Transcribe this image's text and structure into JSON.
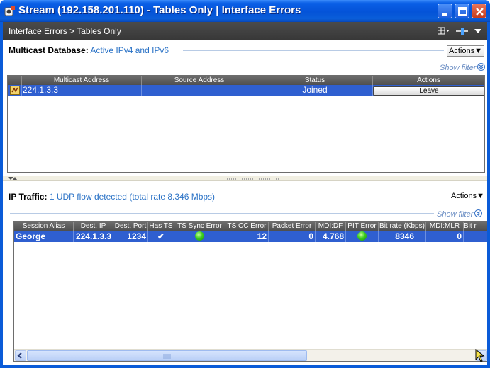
{
  "window": {
    "title": "Stream (192.158.201.110) - Tables Only | Interface Errors",
    "brand_color": "#0453d8"
  },
  "breadcrumb": {
    "text": "Interface Errors > Tables Only"
  },
  "multicast": {
    "label": "Multicast Database:",
    "status": "Active IPv4 and IPv6",
    "actions_label": "Actions",
    "show_filter": "Show filter",
    "columns": [
      "Multicast Address",
      "Source Address",
      "Status",
      "Actions"
    ],
    "rows": [
      {
        "multicast_address": "224.1.3.3",
        "source_address": "",
        "status": "Joined",
        "action": "Leave"
      }
    ]
  },
  "ip_traffic": {
    "label": "IP Traffic:",
    "status": "1 UDP flow detected (total rate 8.346 Mbps)",
    "actions_label": "Actions",
    "show_filter": "Show filter",
    "columns": [
      "Session Alias",
      "Dest. IP",
      "Dest. Port",
      "Has TS",
      "TS Sync Error",
      "TS CC Error",
      "Packet Error",
      "MDI:DF",
      "PIT Error",
      "Bit rate (Kbps)",
      "MDI:MLR",
      "Bit r"
    ],
    "rows": [
      {
        "session_alias": "George",
        "dest_ip": "224.1.3.3",
        "dest_port": "1234",
        "has_ts": "✔",
        "ts_sync_error": "ok",
        "ts_cc_error": "12",
        "packet_error": "0",
        "mdi_df": "4.768",
        "pit_error": "ok",
        "bit_rate": "8346",
        "mdi_mlr": "0",
        "bit_r": ""
      }
    ]
  },
  "colors": {
    "selection": "#2f5fd0",
    "status_ok": "#3ecf1f",
    "link_blue": "#2a72c6"
  }
}
